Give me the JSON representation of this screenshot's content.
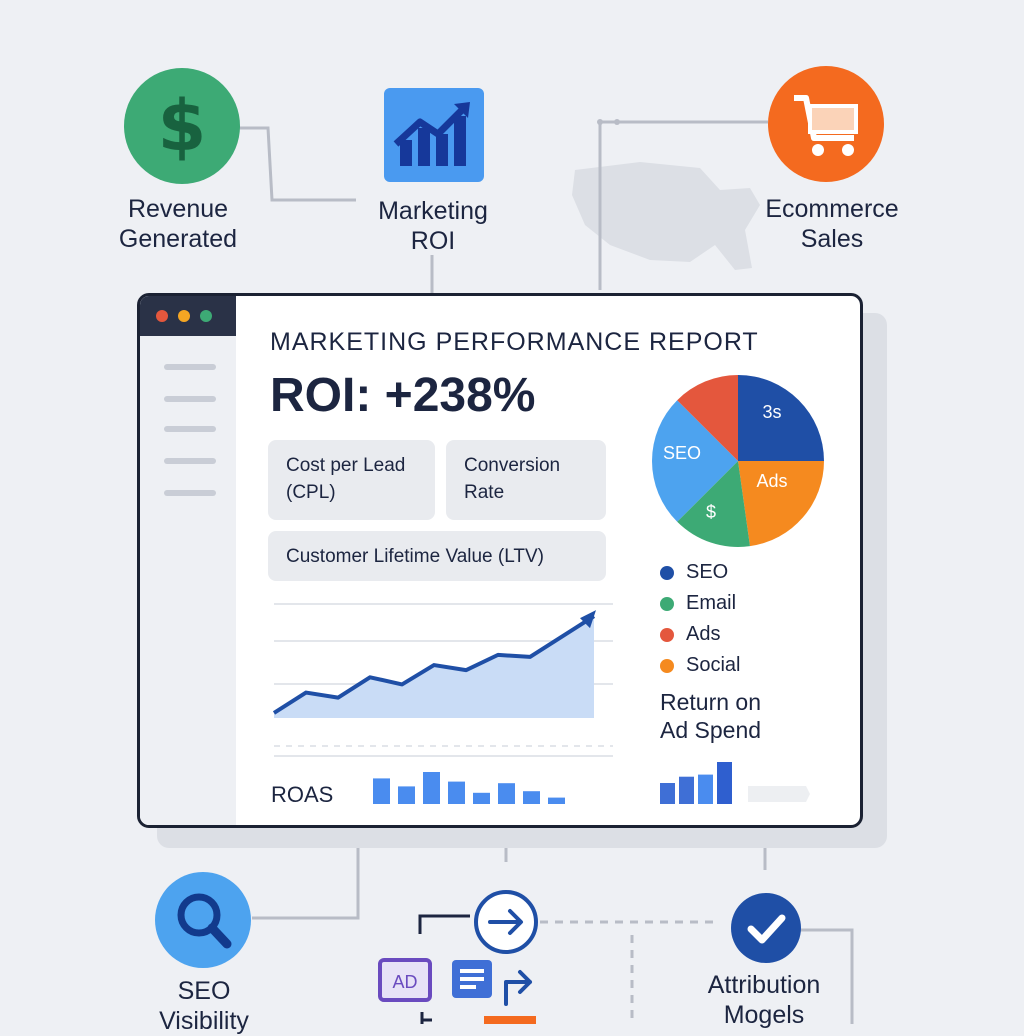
{
  "nodes": {
    "revenue": {
      "label_line1": "Revenue",
      "label_line2": "Generated",
      "icon": "dollar-icon",
      "color": "#3daa75"
    },
    "marketing_roi": {
      "label_line1": "Marketing",
      "label_line2": "ROI",
      "icon": "trend-up-chart-icon",
      "color": "#4a9af0"
    },
    "ecommerce": {
      "label_line1": "Ecommerce",
      "label_line2": "Sales",
      "icon": "shopping-cart-icon",
      "color": "#f46a1f"
    },
    "seo": {
      "label_line1": "SEO",
      "label_line2": "Visibility",
      "icon": "search-icon",
      "color": "#4da3ef"
    },
    "attribution": {
      "label_line1": "Attribution",
      "label_line2": "Mogels",
      "icon": "checkmark-icon",
      "color": "#1f4fa6"
    },
    "flow": {
      "ad_label": "AD",
      "icons": [
        "arrow-right-circle-icon",
        "ad-badge-icon",
        "list-doc-icon",
        "arrow-right-icon"
      ]
    }
  },
  "report": {
    "title": "MARKETING PERFORMANCE REPORT",
    "roi": "ROI: +238%",
    "cards": {
      "cpl_line1": "Cost per Lead",
      "cpl_line2": "(CPL)",
      "conv_line1": "Conversion",
      "conv_line2": "Rate",
      "ltv": "Customer Lifetime Value (LTV)"
    },
    "roas_label": "ROAS",
    "roas_title_line1": "Return on",
    "roas_title_line2": "Ad Spend"
  },
  "pie": {
    "slice_labels": {
      "seo": "SEO",
      "top_right": "3s",
      "ads": "Ads",
      "dollar": "$"
    },
    "colors": {
      "seo": "#4da3ef",
      "red": "#e4573d",
      "blue": "#1f4fa6",
      "orange": "#f58a1f",
      "green": "#3daa75"
    }
  },
  "legend": [
    {
      "label": "SEO",
      "color": "#1f4fa6"
    },
    {
      "label": "Email",
      "color": "#3daa75"
    },
    {
      "label": "Ads",
      "color": "#e4573d"
    },
    {
      "label": "Social",
      "color": "#f58a1f"
    }
  ],
  "chart_data": {
    "type": "area",
    "title": "",
    "xlabel": "",
    "ylabel": "",
    "grid": true,
    "x": [
      1,
      2,
      3,
      4,
      5,
      6,
      7,
      8,
      9,
      10,
      11
    ],
    "values": [
      0.05,
      0.25,
      0.2,
      0.4,
      0.33,
      0.52,
      0.47,
      0.62,
      0.6,
      0.8,
      1.0
    ],
    "ylim": [
      0,
      1.1
    ]
  },
  "roas_bars": [
    0.8,
    0.55,
    1.0,
    0.7,
    0.35,
    0.65,
    0.4,
    0.2
  ],
  "rs_bars": [
    0.5,
    0.65,
    0.7,
    1.0
  ],
  "window_dot_colors": [
    "#e4573d",
    "#f5a623",
    "#3daa75"
  ]
}
